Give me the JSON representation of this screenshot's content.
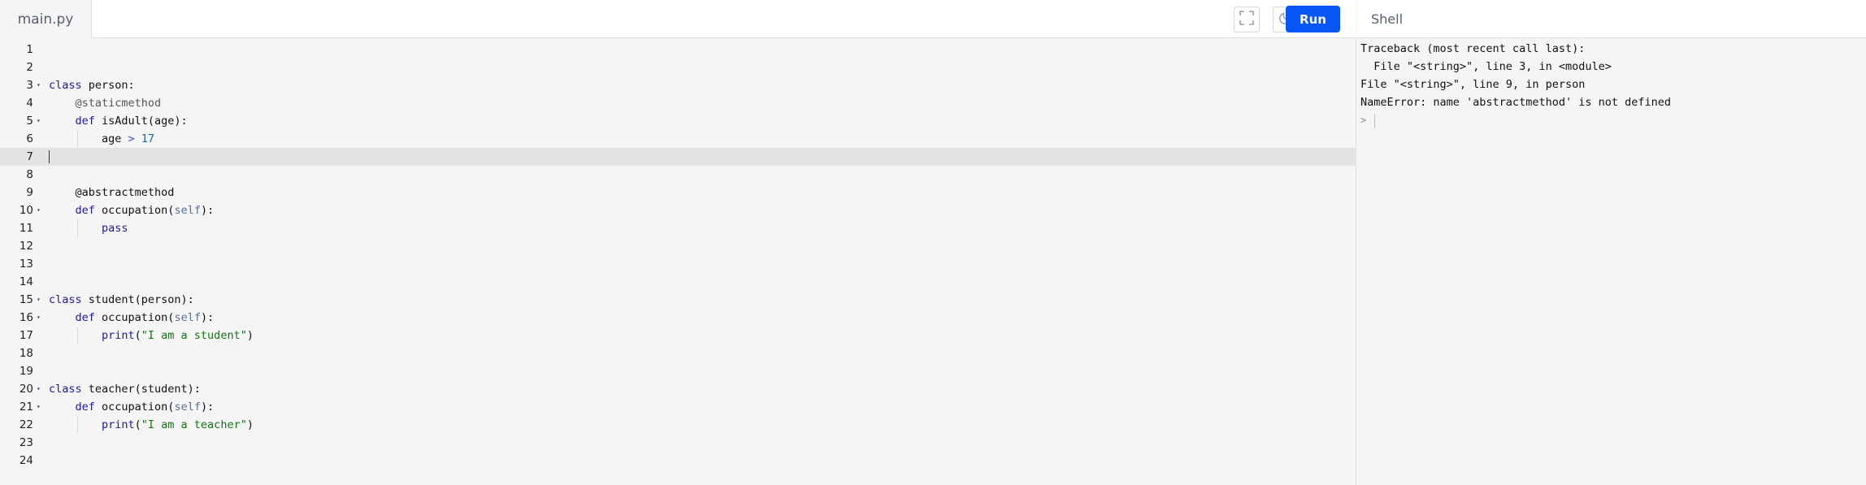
{
  "editor": {
    "file_tab": "main.py",
    "run_label": "Run",
    "active_line": 7,
    "lines": [
      {
        "n": "1",
        "fold": false,
        "indent": 0,
        "tokens": []
      },
      {
        "n": "2",
        "fold": false,
        "indent": 0,
        "tokens": []
      },
      {
        "n": "3",
        "fold": true,
        "indent": 0,
        "tokens": [
          {
            "t": "class",
            "c": "kw"
          },
          {
            "t": " person:",
            "c": ""
          }
        ]
      },
      {
        "n": "4",
        "fold": false,
        "indent": 1,
        "tokens": [
          {
            "t": "@staticmethod",
            "c": "dec"
          }
        ]
      },
      {
        "n": "5",
        "fold": true,
        "indent": 1,
        "tokens": [
          {
            "t": "def",
            "c": "kw"
          },
          {
            "t": " isAdult(age):",
            "c": ""
          }
        ]
      },
      {
        "n": "6",
        "fold": false,
        "indent": 2,
        "tokens": [
          {
            "t": "age ",
            "c": ""
          },
          {
            "t": ">",
            "c": "op"
          },
          {
            "t": " ",
            "c": ""
          },
          {
            "t": "17",
            "c": "num"
          }
        ]
      },
      {
        "n": "7",
        "fold": false,
        "indent": 0,
        "tokens": []
      },
      {
        "n": "8",
        "fold": false,
        "indent": 0,
        "tokens": []
      },
      {
        "n": "9",
        "fold": false,
        "indent": 1,
        "tokens": [
          {
            "t": "@abstractmethod",
            "c": ""
          }
        ]
      },
      {
        "n": "10",
        "fold": true,
        "indent": 1,
        "tokens": [
          {
            "t": "def",
            "c": "kw"
          },
          {
            "t": " occupation(",
            "c": ""
          },
          {
            "t": "self",
            "c": "self"
          },
          {
            "t": "):",
            "c": ""
          }
        ]
      },
      {
        "n": "11",
        "fold": false,
        "indent": 2,
        "tokens": [
          {
            "t": "pass",
            "c": "kw"
          }
        ]
      },
      {
        "n": "12",
        "fold": false,
        "indent": 0,
        "tokens": []
      },
      {
        "n": "13",
        "fold": false,
        "indent": 0,
        "tokens": []
      },
      {
        "n": "14",
        "fold": false,
        "indent": 0,
        "tokens": []
      },
      {
        "n": "15",
        "fold": true,
        "indent": 0,
        "tokens": [
          {
            "t": "class",
            "c": "kw"
          },
          {
            "t": " student(person):",
            "c": ""
          }
        ]
      },
      {
        "n": "16",
        "fold": true,
        "indent": 1,
        "tokens": [
          {
            "t": "def",
            "c": "kw"
          },
          {
            "t": " occupation(",
            "c": ""
          },
          {
            "t": "self",
            "c": "self"
          },
          {
            "t": "):",
            "c": ""
          }
        ]
      },
      {
        "n": "17",
        "fold": false,
        "indent": 2,
        "tokens": [
          {
            "t": "print",
            "c": "bi"
          },
          {
            "t": "(",
            "c": ""
          },
          {
            "t": "\"I am a student\"",
            "c": "str"
          },
          {
            "t": ")",
            "c": ""
          }
        ]
      },
      {
        "n": "18",
        "fold": false,
        "indent": 0,
        "tokens": []
      },
      {
        "n": "19",
        "fold": false,
        "indent": 0,
        "tokens": []
      },
      {
        "n": "20",
        "fold": true,
        "indent": 0,
        "tokens": [
          {
            "t": "class",
            "c": "kw"
          },
          {
            "t": " teacher(student):",
            "c": ""
          }
        ]
      },
      {
        "n": "21",
        "fold": true,
        "indent": 1,
        "tokens": [
          {
            "t": "def",
            "c": "kw"
          },
          {
            "t": " occupation(",
            "c": ""
          },
          {
            "t": "self",
            "c": "self"
          },
          {
            "t": "):",
            "c": ""
          }
        ]
      },
      {
        "n": "22",
        "fold": false,
        "indent": 2,
        "tokens": [
          {
            "t": "print",
            "c": "bi"
          },
          {
            "t": "(",
            "c": ""
          },
          {
            "t": "\"I am a teacher\"",
            "c": "str"
          },
          {
            "t": ")",
            "c": ""
          }
        ]
      },
      {
        "n": "23",
        "fold": false,
        "indent": 0,
        "tokens": []
      },
      {
        "n": "24",
        "fold": false,
        "indent": 0,
        "tokens": []
      }
    ]
  },
  "toolbar": {
    "fullscreen_icon": "fullscreen-icon",
    "theme_icon": "moon-icon"
  },
  "shell": {
    "title": "Shell",
    "output": [
      "Traceback (most recent call last):",
      "  File \"<string>\", line 3, in <module>",
      "File \"<string>\", line 9, in person",
      "NameError: name 'abstractmethod' is not defined"
    ],
    "prompt": ">"
  },
  "colors": {
    "run_button": "#0556f3",
    "keyword": "#1a1aa6",
    "string": "#117711",
    "number": "#1a64b8",
    "active_line": "#e3e3e3"
  }
}
